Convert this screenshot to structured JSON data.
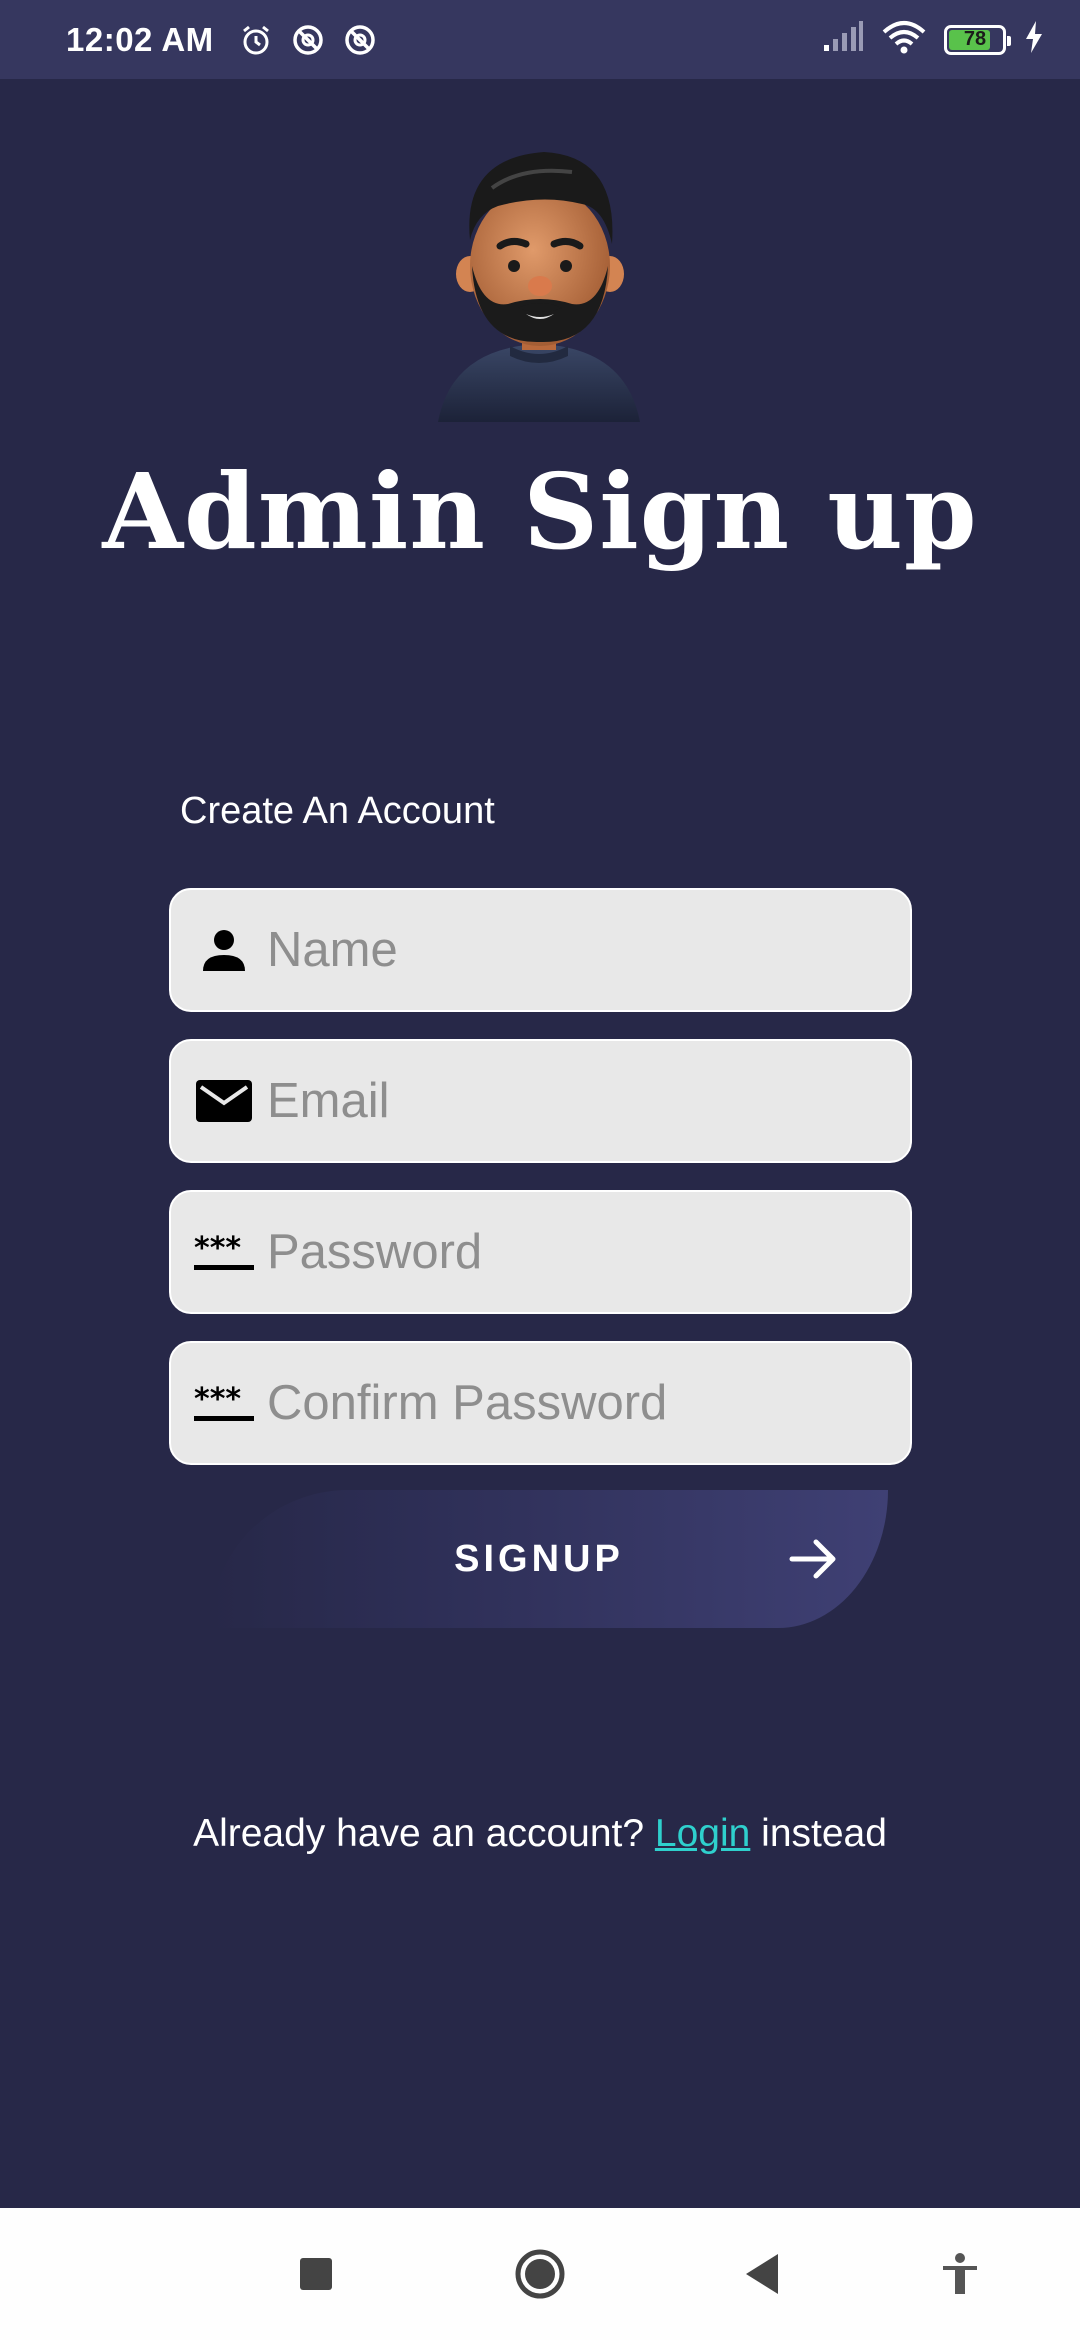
{
  "status_bar": {
    "time": "12:02 AM",
    "battery_level": "78",
    "icons": [
      "alarm-icon",
      "sync-off-icon",
      "sync-off-icon",
      "signal-icon",
      "wifi-icon",
      "battery-icon",
      "charging-icon"
    ]
  },
  "page": {
    "title": "Admin Sign up",
    "subtitle": "Create An Account"
  },
  "form": {
    "name_placeholder": "Name",
    "email_placeholder": "Email",
    "password_placeholder": "Password",
    "confirm_password_placeholder": "Confirm Password",
    "signup_label": "SIGNUP"
  },
  "footer": {
    "prefix": "Already have an account? ",
    "link": "Login",
    "suffix": " instead"
  },
  "colors": {
    "background": "#272848",
    "status_bar": "#36375f",
    "field": "#e8e8e8",
    "link": "#2fd0cd"
  }
}
